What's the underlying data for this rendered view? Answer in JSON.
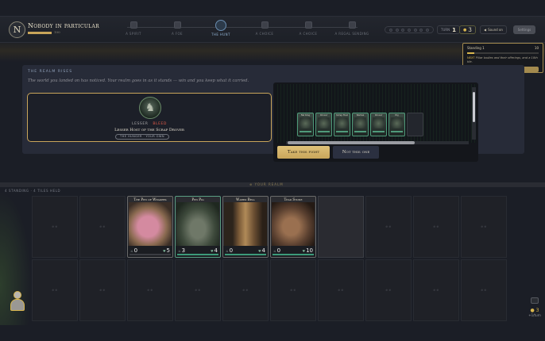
{
  "player": {
    "initial": "N",
    "name": "Nobody in particular",
    "xp_value": "100",
    "xp_fraction": 1.0
  },
  "steps": [
    {
      "label": "A SPIRIT",
      "active": false
    },
    {
      "label": "A FOE",
      "active": false
    },
    {
      "label": "THE HUNT",
      "active": true
    },
    {
      "label": "A CHOICE",
      "active": false
    },
    {
      "label": "A CHOICE",
      "active": false
    },
    {
      "label": "A REGAL SENDING",
      "active": false
    }
  ],
  "status": {
    "turn_label": "TURN",
    "turn_value": "1",
    "gold_value": "3",
    "sound_label": "Sound on",
    "settings_label": "Settings"
  },
  "standing_popover": {
    "label": "Standing",
    "value": "1",
    "max": "10",
    "progress_fraction": 0.1,
    "note_prefix": "NEXT",
    "note_text": "Pillar bodies and their offerings, and a 10th tile.",
    "button_label": "TRIP — +"
  },
  "realm": {
    "title": "THE REALM RISES",
    "subtitle": "The world you landed on has noticed. Your realm goes in as it stands — win and you keep what it carried.",
    "enemy": {
      "tier": "LESSER",
      "keyword": "BLEED",
      "name": "Lesser Host of the Scrap Drover",
      "tag": "THE HUNGER · YOUR OWN"
    }
  },
  "picker": {
    "minis": [
      "Rat King",
      "Drover",
      "Scrap Host",
      "Warren",
      "Drover",
      "Pig"
    ],
    "take_label": "Take this fight",
    "not_label": "Not this one"
  },
  "board": {
    "standing_label": "4 STANDING · 4 TILES HELD",
    "divider_mark": "⊕ YOUR REALM",
    "empty_tile_label": "⊕ ⊕",
    "cards": [
      {
        "name": "The Pen of Weakers",
        "atk": "0",
        "hp": "5",
        "style": "plain",
        "art": "pink"
      },
      {
        "name": "Pen Pig",
        "atk": "3",
        "hp": "4",
        "style": "green",
        "art": "boar"
      },
      {
        "name": "Wared Bell",
        "atk": "0",
        "hp": "4",
        "style": "plain",
        "art": "mine"
      },
      {
        "name": "Tead Stone",
        "atk": "0",
        "hp": "10",
        "style": "plain",
        "art": "tusk"
      }
    ]
  },
  "side": {
    "gold": "3",
    "note": "+1/turn"
  },
  "colors": {
    "accent_gold": "#c9a55a",
    "bleed_red": "#e05a48",
    "card_green": "#5a9e82",
    "panel_navy": "#272b38"
  }
}
